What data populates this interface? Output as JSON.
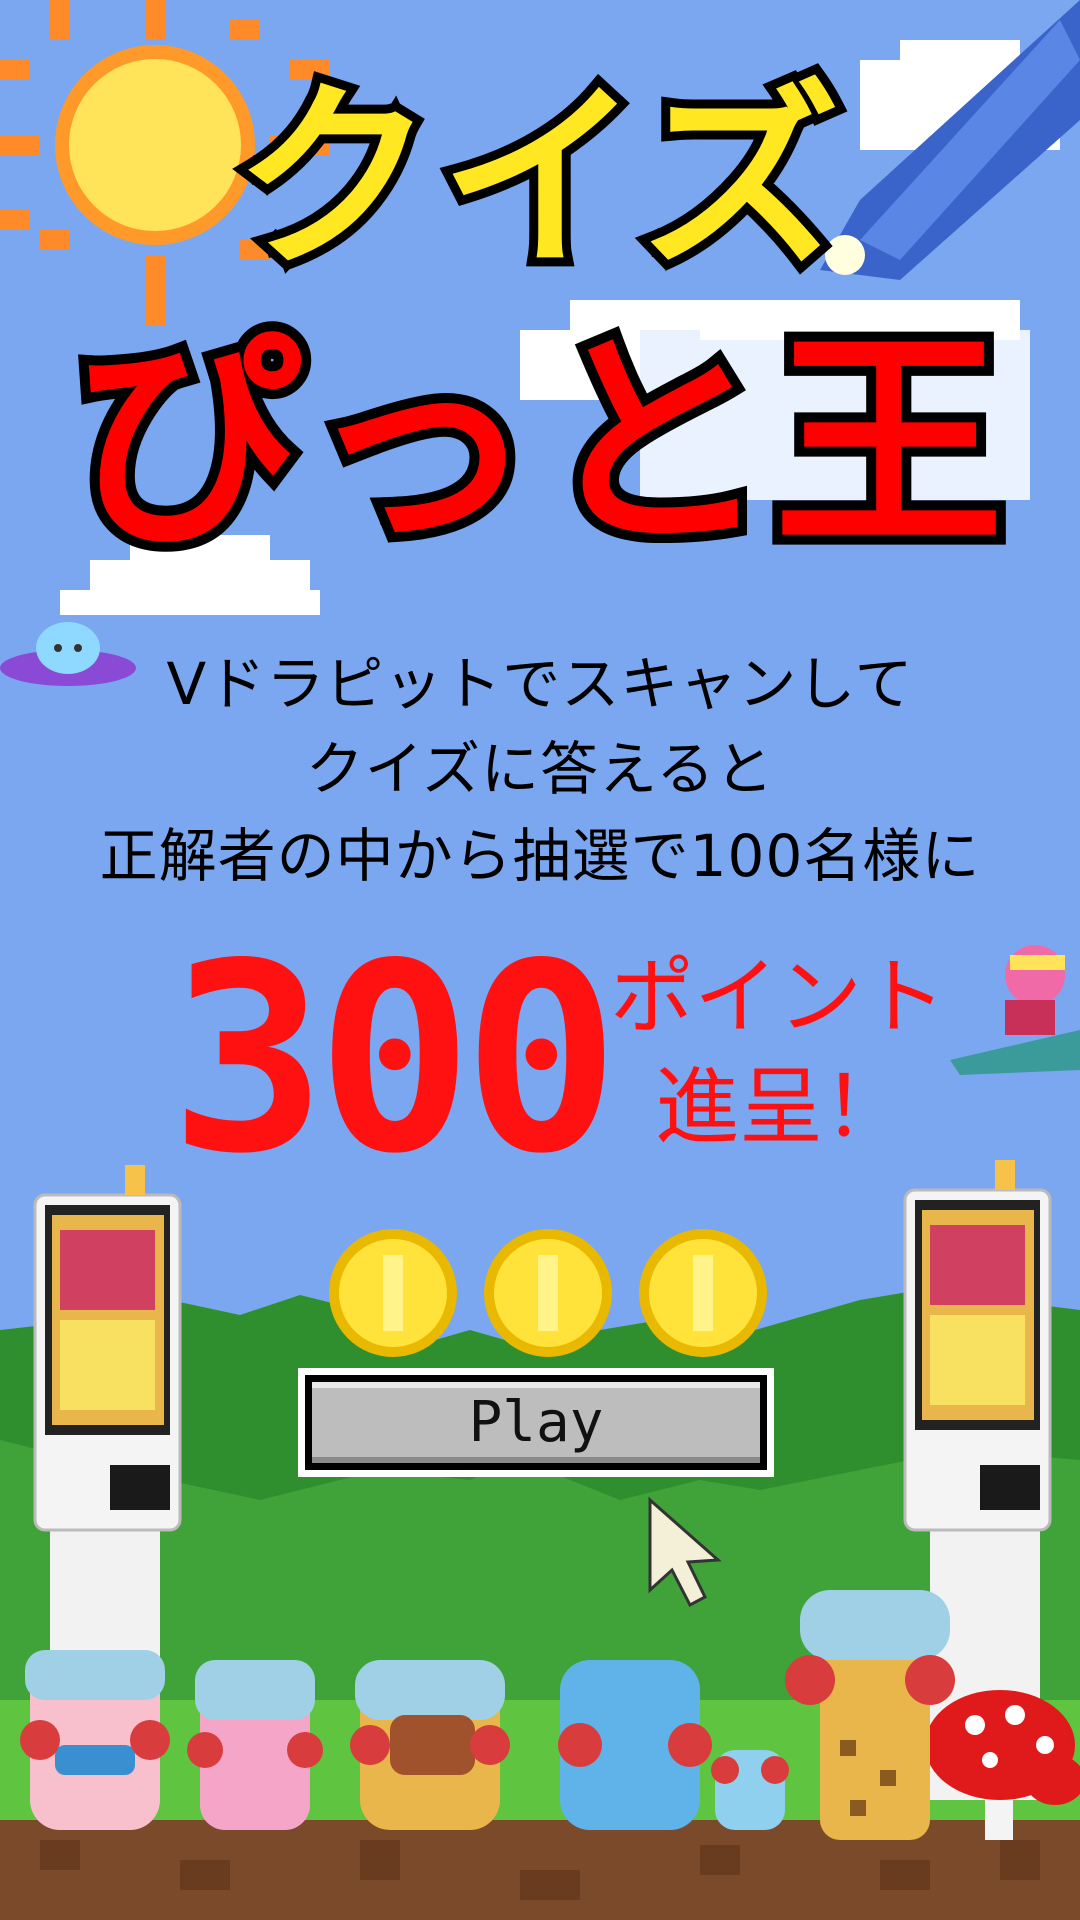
{
  "title": {
    "line1": "クイズ",
    "line2": "ぴっと王"
  },
  "description": {
    "line1": "Vドラピットでスキャンして",
    "line2": "クイズに答えると",
    "line3": "正解者の中から抽選で100名様に"
  },
  "prize": {
    "amount": "300",
    "unit": "ポイント",
    "suffix": "進呈！"
  },
  "coins": {
    "count": 3
  },
  "play_button": {
    "label": "Play"
  },
  "colors": {
    "sky": "#7aa7ef",
    "title_yellow": "#ffe822",
    "title_red": "#ff0000",
    "prize_red": "#ff1111",
    "grass_dark": "#2e8a2b",
    "grass_light": "#5fc43f",
    "dirt": "#7a4a2a"
  },
  "icons": [
    "sun-icon",
    "comet-icon",
    "ufo-icon",
    "rider-icon",
    "coin-icon",
    "kiosk-icon",
    "cursor-icon",
    "mushroom-icon"
  ]
}
